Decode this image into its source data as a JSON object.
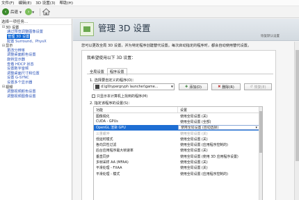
{
  "menu": [
    "文件(F)",
    "编辑(E)",
    "3D 设置(3)",
    "帮助(H)"
  ],
  "toolbar": {
    "back_label": "后退"
  },
  "left_panel": {
    "title": "选择一项任务...",
    "tree": [
      {
        "type": "cat",
        "toggle": "⊟",
        "label": "3D 设置"
      },
      {
        "type": "item",
        "label": "通过预览调整图像设置"
      },
      {
        "type": "item",
        "label": "管理 3D 设置",
        "selected": true
      },
      {
        "type": "item",
        "label": "配置 Surround、PhysX"
      },
      {
        "type": "cat",
        "toggle": "⊟",
        "label": "显示"
      },
      {
        "type": "item",
        "label": "更改分辨率"
      },
      {
        "type": "item",
        "label": "调整桌面颜色设置"
      },
      {
        "type": "item",
        "label": "旋转显示器"
      },
      {
        "type": "item",
        "label": "查看 HDCP 状态"
      },
      {
        "type": "item",
        "label": "设置数字音频"
      },
      {
        "type": "item",
        "label": "调整桌面尺寸和位置"
      },
      {
        "type": "item",
        "label": "设置 G-SYNC"
      },
      {
        "type": "item",
        "label": "设置多个显示器"
      },
      {
        "type": "cat",
        "toggle": "⊟",
        "label": "视频"
      },
      {
        "type": "item",
        "label": "调整视频颜色设置"
      },
      {
        "type": "item",
        "label": "调整视频图像设置"
      }
    ]
  },
  "header": {
    "title": "管理 3D 设置",
    "subtitle": "恢复默认设置"
  },
  "description": "您可以更改全局 3D 设置，并为特定程序创建替代设置。每次启动指定的程序时，都会自动使用替代设置。",
  "panel": {
    "heading": "我希望使用以下 3D 设置：",
    "tabs": [
      "全局设置",
      "程序设置"
    ],
    "active_tab": 1,
    "step1_label": "1. 选择要自定义的程序(O)：",
    "program_value": "d:\\gl\\hypergryph launcher\\game...",
    "add_button": "添加(D)",
    "remove_button": "删除(R)",
    "restore_button": "恢复(E)",
    "checkbox_label": "只显示本计算机上找到的程序(M)",
    "step2_label": "2. 指定该程序的设置(S)：",
    "columns": [
      "功能",
      "设置"
    ],
    "rows": [
      {
        "feature": "图像锐化",
        "setting": "使用全局设置 (关)"
      },
      {
        "feature": "CUDA - GPUs",
        "setting": "使用全局设置 (全部)"
      },
      {
        "feature": "OpenGL 渲染 GPU",
        "setting": "使用全局设置 (自动选择)",
        "selected": true
      },
      {
        "feature": "三重缓冲",
        "setting": "使用全局设置 (关)",
        "dim": true
      },
      {
        "feature": "低延时模式",
        "setting": "使用全局设置 (关)"
      },
      {
        "feature": "各向异性过滤",
        "setting": "使用全局设置 (应用程序控制的)"
      },
      {
        "feature": "后台应用程序最大帧速率",
        "setting": "使用全局设置 (关)"
      },
      {
        "feature": "垂直同步",
        "setting": "使用全局设置 (使用 3D 应用程序设置)"
      },
      {
        "feature": "多帧采样 AA (MFAA)",
        "setting": "使用全局设置 (关)"
      },
      {
        "feature": "平滑处理 - FXAA",
        "setting": "使用全局设置 (关)"
      },
      {
        "feature": "平滑处理 - 模式",
        "setting": "使用全局设置 (应用程序控制的)"
      }
    ]
  }
}
